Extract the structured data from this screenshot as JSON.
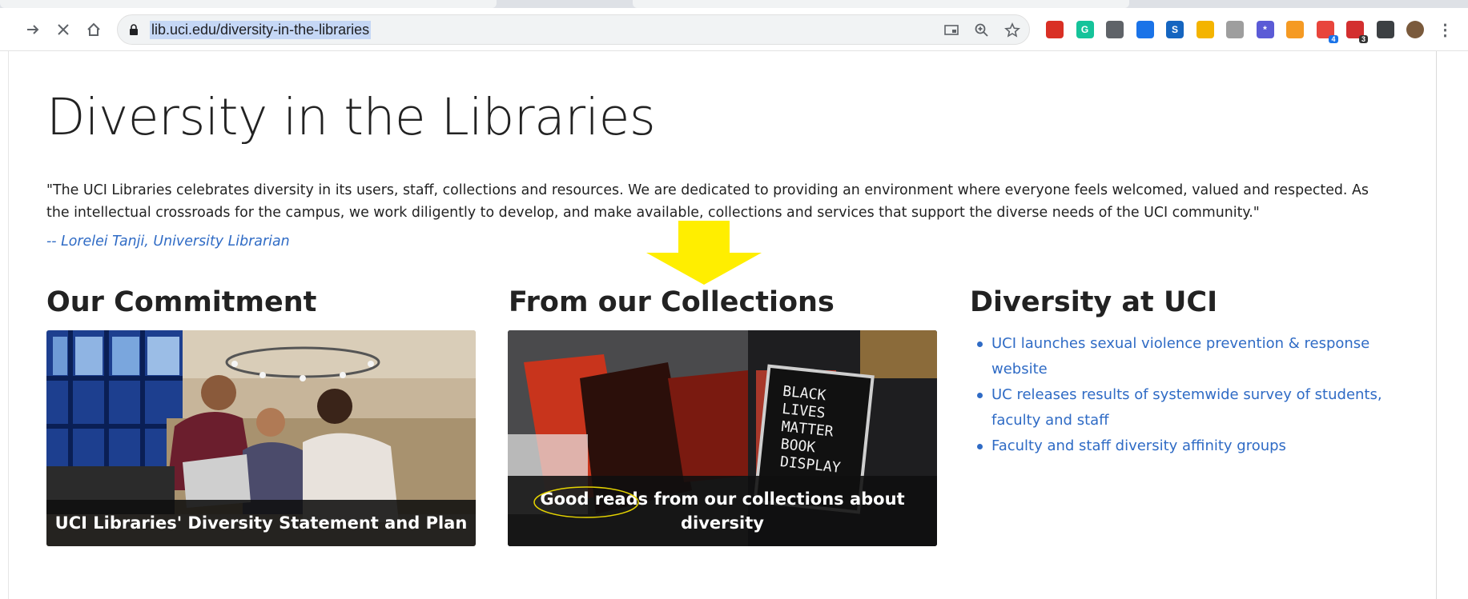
{
  "browser": {
    "url": "lib.uci.edu/diversity-in-the-libraries",
    "nav_icons": [
      "forward-arrow-icon",
      "close-icon",
      "home-icon"
    ],
    "omnibox_icons": [
      "cast-icon",
      "zoom-icon",
      "star-icon"
    ],
    "extensions": [
      {
        "name": "bookmark-ext-icon",
        "color": "#d93025",
        "label": ""
      },
      {
        "name": "grammarly-ext-icon",
        "color": "#15c39a",
        "label": "G"
      },
      {
        "name": "clip-ext-icon",
        "color": "#5f6368",
        "label": ""
      },
      {
        "name": "compass-ext-icon",
        "color": "#1a73e8",
        "label": ""
      },
      {
        "name": "s-ext-icon",
        "color": "#1565c0",
        "label": "S"
      },
      {
        "name": "hand-ext-icon",
        "color": "#f4b400",
        "label": ""
      },
      {
        "name": "circle-ext-icon",
        "color": "#9e9e9e",
        "label": ""
      },
      {
        "name": "snowflake-ext-icon",
        "color": "#5b5bd6",
        "label": "*"
      },
      {
        "name": "rss-ext-icon",
        "color": "#f59a23",
        "label": ""
      },
      {
        "name": "pen-ext-icon",
        "color": "#e8453c",
        "label": "",
        "badge": "4"
      },
      {
        "name": "calendar-ext-icon",
        "color": "#d32f2f",
        "label": "",
        "badge": "3"
      },
      {
        "name": "puzzle-ext-icon",
        "color": "#3c4043",
        "label": ""
      },
      {
        "name": "avatar",
        "color": "#7a5a3c",
        "label": ""
      },
      {
        "name": "menu-icon",
        "color": "#5f6368",
        "label": "⋮"
      }
    ]
  },
  "page": {
    "title": "Diversity in the Libraries",
    "quote": "\"The UCI Libraries celebrates diversity in its users, staff, collections and resources. We are dedicated to providing an environment where everyone feels welcomed, valued and respected. As the intellectual crossroads for the campus, we work diligently to develop, and make available, collections and services that support the diverse needs of the UCI community.\"",
    "attribution": "-- Lorelei Tanji, University Librarian",
    "sections": {
      "commitment": {
        "heading": "Our Commitment",
        "card_caption": "UCI Libraries' Diversity Statement and Plan"
      },
      "collections": {
        "heading": "From our Collections",
        "card_caption_highlight": "Good reads",
        "card_caption_rest": " from our collections about diversity",
        "sign_lines": [
          "BLACK",
          "LIVES",
          "MATTER",
          "BOOK",
          "DISPLAY"
        ]
      },
      "diversity_uci": {
        "heading": "Diversity at UCI",
        "links": [
          "UCI launches sexual violence prevention & response website",
          "UC releases results of systemwide survey of students, faculty and staff",
          "Faculty and staff diversity affinity groups"
        ]
      }
    },
    "annotation_color": "#ffee00"
  }
}
